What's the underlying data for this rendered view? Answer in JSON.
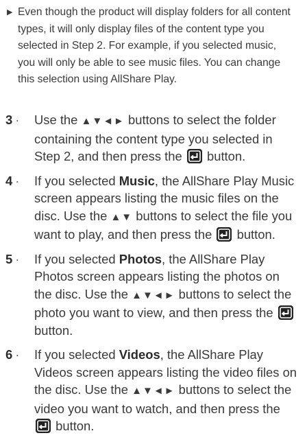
{
  "note": {
    "bullet_icon": "right-triangle-bullet",
    "text": "Even though the product will display folders for all content types, it will only display files of the content type you selected in Step 2. For example, if you selected music, you will only be able to see music files. You can change this selection using AllShare Play."
  },
  "steps": [
    {
      "num": "3",
      "sep": "·",
      "p1": "Use the",
      "arrows": "▲▼◄►",
      "p2": "buttons to select the folder containing the content type you selected in Step 2, and then press the",
      "p3": "button."
    },
    {
      "num": "4",
      "sep": "·",
      "p1": "If you selected",
      "bold": "Music",
      "p2": ", the AllShare Play Music screen appears listing the music files on the disc. Use the",
      "arrows": "▲▼",
      "p3": "buttons to select the file you want to play, and then press the",
      "p4": "button."
    },
    {
      "num": "5",
      "sep": "·",
      "p1": "If you selected",
      "bold": "Photos",
      "p2": ", the AllShare Play Photos screen appears listing the photos on the disc. Use the",
      "arrows": "▲▼◄►",
      "p3": "buttons to select the photo you want to view, and then press the",
      "p4": "button."
    },
    {
      "num": "6",
      "sep": "·",
      "p1": "If you selected",
      "bold": "Videos",
      "p2": ", the AllShare Play Videos screen appears listing the video files on the disc. Use the",
      "arrows": "▲▼◄►",
      "p3": "buttons to select the video you want to watch, and then press the",
      "p4": "button."
    }
  ],
  "icons": {
    "enter": "enter-button-icon"
  },
  "colors": {
    "text": "#3a3a3a",
    "icon_bg": "#222222"
  }
}
